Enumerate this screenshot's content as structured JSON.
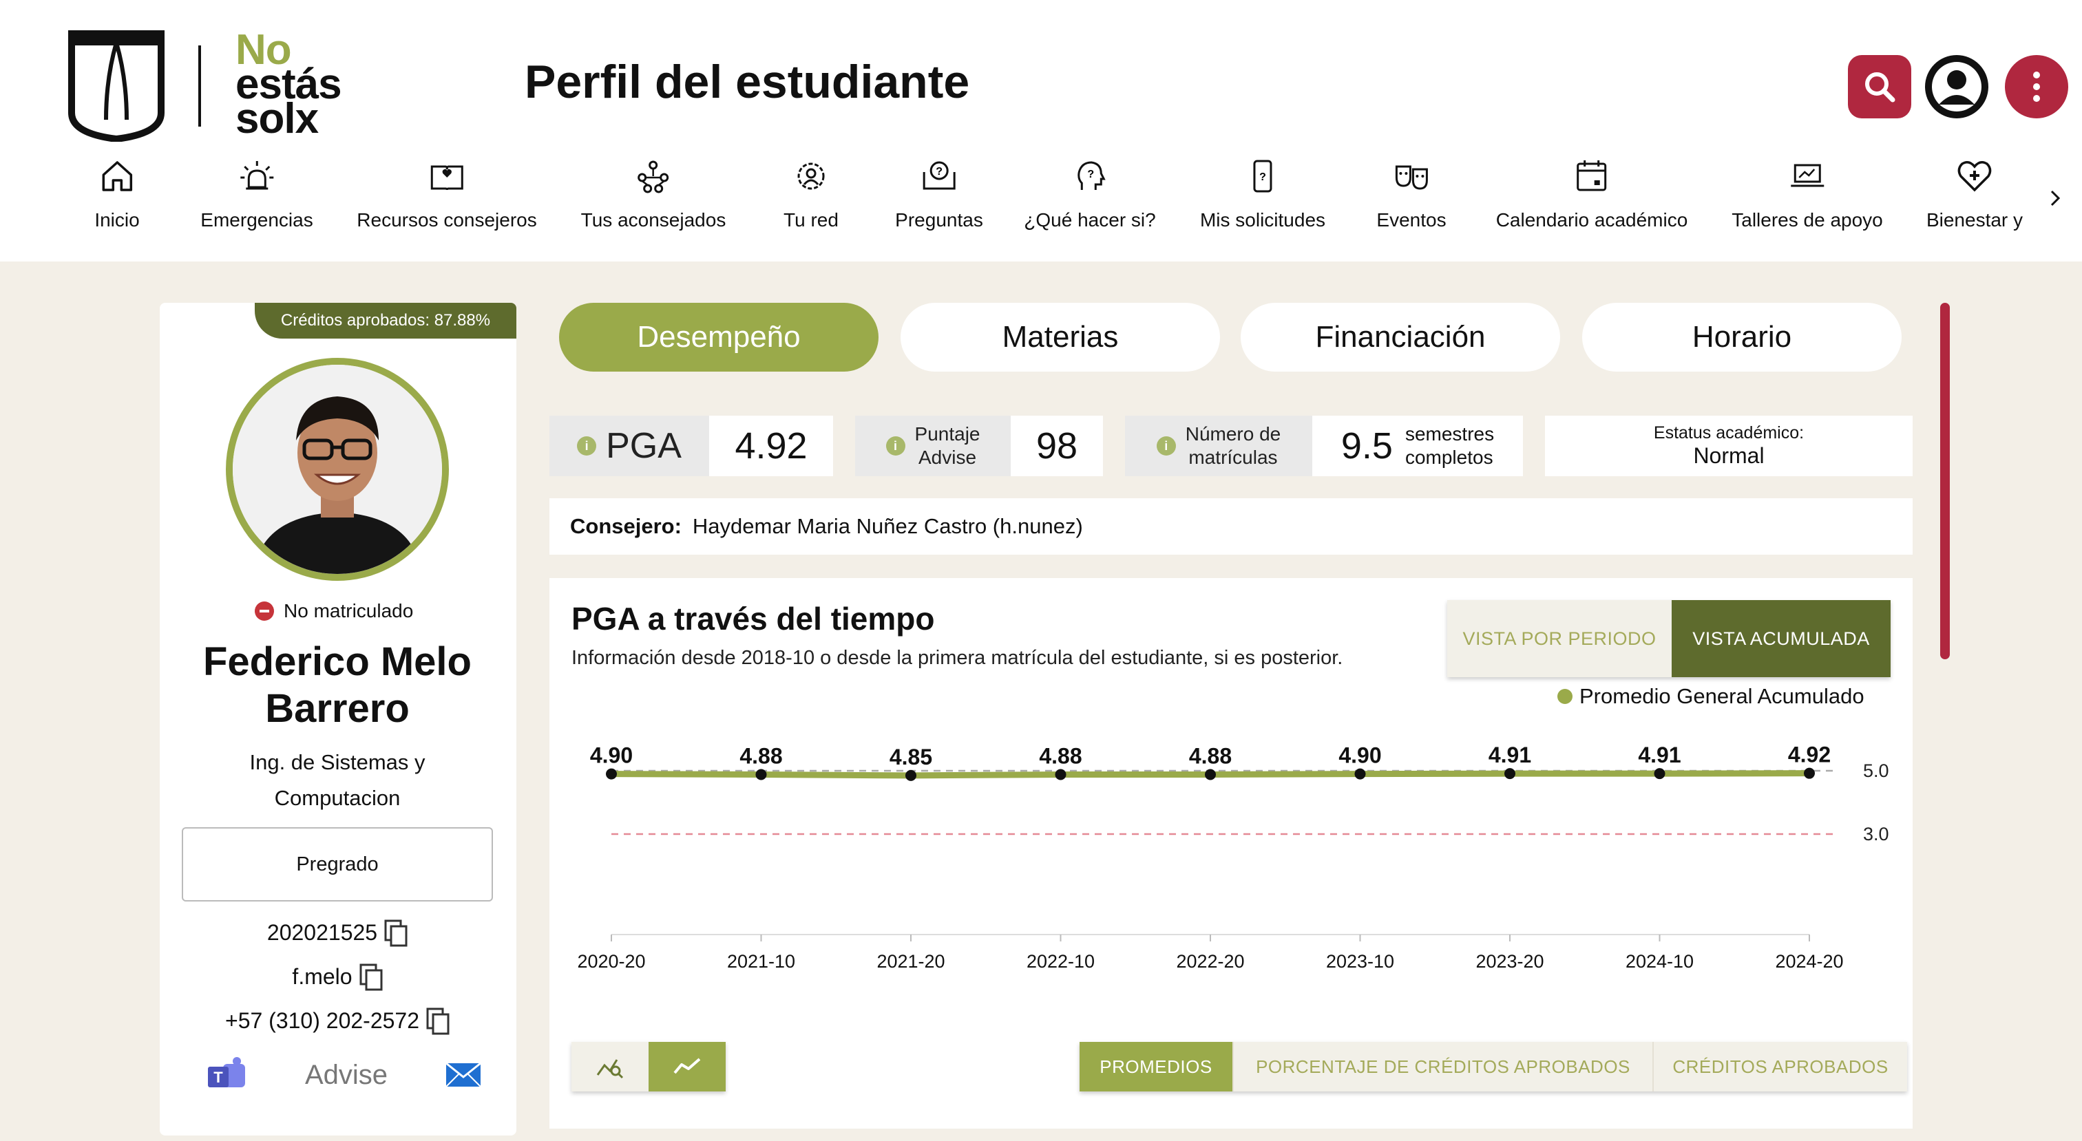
{
  "header": {
    "logo_text": [
      "No",
      "estás",
      "solx"
    ],
    "title": "Perfil del estudiante",
    "icons": [
      "search-icon",
      "user-icon",
      "more-vertical-icon"
    ],
    "accent": "#b0273f"
  },
  "nav": {
    "items": [
      {
        "label": "Inicio",
        "icon": "home-icon"
      },
      {
        "label": "Emergencias",
        "icon": "alarm-icon"
      },
      {
        "label": "Recursos consejeros",
        "icon": "book-heart-icon"
      },
      {
        "label": "Tus aconsejados",
        "icon": "people-network-icon"
      },
      {
        "label": "Tu red",
        "icon": "network-icon"
      },
      {
        "label": "Preguntas",
        "icon": "question-book-icon"
      },
      {
        "label": "¿Qué hacer si?",
        "icon": "question-head-icon"
      },
      {
        "label": "Mis solicitudes",
        "icon": "request-phone-icon"
      },
      {
        "label": "Eventos",
        "icon": "theater-masks-icon"
      },
      {
        "label": "Calendario académico",
        "icon": "calendar-icon"
      },
      {
        "label": "Talleres de apoyo",
        "icon": "laptop-workshop-icon"
      },
      {
        "label": "Bienestar y",
        "icon": "heart-plus-icon"
      }
    ]
  },
  "profile": {
    "credits_tag": "Créditos aprobados: 87.88%",
    "status": "No matriculado",
    "name": "Federico Melo Barrero",
    "program_line1": "Ing. de Sistemas y",
    "program_line2": "Computacion",
    "level": "Pregrado",
    "code": "202021525",
    "user": "f.melo",
    "phone": "+57 (310) 202-2572",
    "advise_label": "Advise"
  },
  "tabs": [
    {
      "label": "Desempeño",
      "active": true
    },
    {
      "label": "Materias",
      "active": false
    },
    {
      "label": "Financiación",
      "active": false
    },
    {
      "label": "Horario",
      "active": false
    }
  ],
  "stats": {
    "pga_label": "PGA",
    "pga_value": "4.92",
    "advise_label_1": "Puntaje",
    "advise_label_2": "Advise",
    "advise_value": "98",
    "matriculas_label_1": "Número de",
    "matriculas_label_2": "matrículas",
    "matriculas_value": "9.5",
    "matriculas_unit_1": "semestres",
    "matriculas_unit_2": "completos",
    "estatus_label": "Estatus académico:",
    "estatus_value": "Normal"
  },
  "consejero": {
    "label": "Consejero:",
    "value": "Haydemar Maria Nuñez Castro (h.nunez)"
  },
  "chart_section": {
    "title": "PGA a través del tiempo",
    "subtitle": "Información desde 2018-10 o desde la primera matrícula del estudiante, si es posterior.",
    "view_period": "VISTA POR PERIODO",
    "view_cumulative": "VISTA ACUMULADA",
    "metric_tabs": [
      "PROMEDIOS",
      "PORCENTAJE DE CRÉDITOS APROBADOS",
      "CRÉDITOS APROBADOS"
    ]
  },
  "chart_data": {
    "type": "line",
    "categories": [
      "2020-20",
      "2021-10",
      "2021-20",
      "2022-10",
      "2022-20",
      "2023-10",
      "2023-20",
      "2024-10",
      "2024-20"
    ],
    "series": [
      {
        "name": "Promedio General Acumulado",
        "values": [
          4.9,
          4.88,
          4.85,
          4.88,
          4.88,
          4.9,
          4.91,
          4.91,
          4.92
        ],
        "color": "#9aaa4a"
      }
    ],
    "data_labels": [
      "4.90",
      "4.88",
      "4.85",
      "4.88",
      "4.88",
      "4.90",
      "4.91",
      "4.91",
      "4.92"
    ],
    "reference_lines": [
      {
        "value": 5.0,
        "label": "5.0",
        "color": "#aaaaaa"
      },
      {
        "value": 3.0,
        "label": "3.0",
        "color": "#e58a96"
      }
    ],
    "legend_position": "top-right"
  }
}
